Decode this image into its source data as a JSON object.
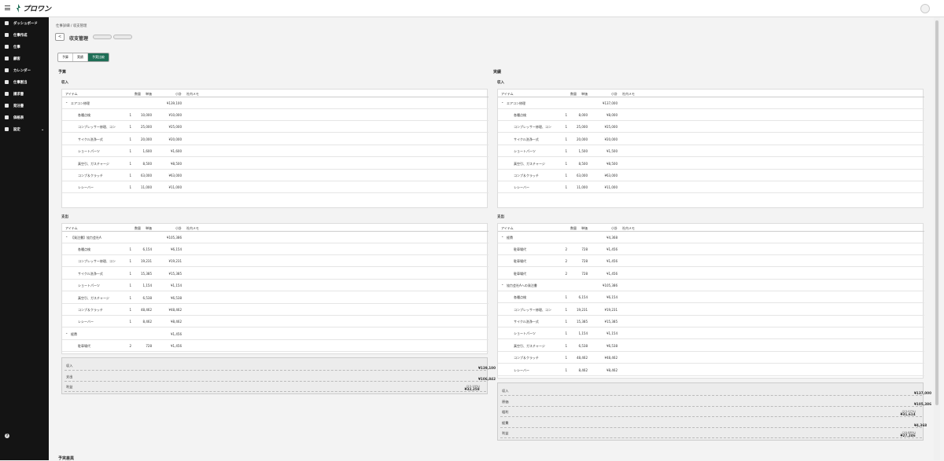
{
  "app": {
    "title": "プロワン"
  },
  "sidebar": {
    "items": [
      {
        "icon": "dashboard-icon",
        "label": "ダッシュボード"
      },
      {
        "icon": "job-create-icon",
        "label": "仕事作成"
      },
      {
        "icon": "job-icon",
        "label": "仕事"
      },
      {
        "icon": "customer-icon",
        "label": "顧客"
      },
      {
        "icon": "calendar-icon",
        "label": "カレンダー"
      },
      {
        "icon": "dispatch-icon",
        "label": "仕事割当"
      },
      {
        "icon": "invoice-icon",
        "label": "請求書"
      },
      {
        "icon": "order-icon",
        "label": "発注書"
      },
      {
        "icon": "price-icon",
        "label": "価格表"
      },
      {
        "icon": "gear-icon",
        "label": "設定"
      }
    ]
  },
  "breadcrumb": {
    "parent": "仕事詳細",
    "sep": "/",
    "current": "収支管理"
  },
  "page": {
    "title": "収支管理",
    "back": "<"
  },
  "tabs": [
    "予算",
    "実績",
    "予実比較"
  ],
  "budget": {
    "title": "予算",
    "income": {
      "title": "収入",
      "header": [
        "アイテム",
        "数量",
        "単価",
        "小計",
        "社内メモ"
      ],
      "group": {
        "name": "エアコン修理",
        "subtotal": "¥139,100"
      },
      "rows": [
        [
          "各種点検",
          "1",
          "10,000",
          "¥10,000"
        ],
        [
          "コンプレッサー修理、コン",
          "1",
          "25,000",
          "¥25,000"
        ],
        [
          "サイクル洗浄一式",
          "1",
          "20,000",
          "¥20,000"
        ],
        [
          "ショートパーツ",
          "1",
          "1,600",
          "¥1,600"
        ],
        [
          "真空引、ガスチャージ",
          "1",
          "8,500",
          "¥8,500"
        ],
        [
          "コンプ＆クラッチ",
          "1",
          "63,000",
          "¥63,000"
        ],
        [
          "レシーバー",
          "1",
          "11,000",
          "¥11,000"
        ]
      ]
    },
    "expense": {
      "title": "支出",
      "header": [
        "アイテム",
        "数量",
        "単価",
        "小計",
        "社内メモ"
      ],
      "group1": {
        "name": "【発注書】協力会社A",
        "subtotal": "¥105,386"
      },
      "rows1": [
        [
          "各種点検",
          "1",
          "6,154",
          "¥6,154"
        ],
        [
          "コンプレッサー修理、コン",
          "1",
          "19,231",
          "¥19,231"
        ],
        [
          "サイクル洗浄一式",
          "1",
          "15,385",
          "¥15,385"
        ],
        [
          "ショートパーツ",
          "1",
          "1,154",
          "¥1,154"
        ],
        [
          "真空引、ガスチャージ",
          "1",
          "6,538",
          "¥6,538"
        ],
        [
          "コンプ＆クラッチ",
          "1",
          "48,462",
          "¥48,462"
        ],
        [
          "レシーバー",
          "1",
          "8,462",
          "¥8,462"
        ]
      ],
      "group2": {
        "name": "経費",
        "subtotal": "¥1,456"
      },
      "rows2": [
        [
          "駐車場代",
          "2",
          "728",
          "¥1,456"
        ]
      ]
    },
    "summary": [
      {
        "label": "収入",
        "value": "¥139,100",
        "pct": ""
      },
      {
        "label": "支出",
        "value": "¥106,842",
        "pct": ""
      },
      {
        "label": "利益",
        "value": "¥32,258",
        "pct": "(23.19%)"
      }
    ]
  },
  "actual": {
    "title": "実績",
    "income": {
      "title": "収入",
      "header": [
        "アイテム",
        "数量",
        "単価",
        "小計",
        "社内メモ"
      ],
      "group": {
        "name": "エアコン修理",
        "subtotal": "¥137,000"
      },
      "rows": [
        [
          "各種点検",
          "1",
          "8,000",
          "¥8,000"
        ],
        [
          "コンプレッサー修理、コン",
          "1",
          "25,000",
          "¥25,000"
        ],
        [
          "サイクル洗浄一式",
          "1",
          "20,000",
          "¥20,000"
        ],
        [
          "ショートパーツ",
          "1",
          "1,500",
          "¥1,500"
        ],
        [
          "真空引、ガスチャージ",
          "1",
          "8,500",
          "¥8,500"
        ],
        [
          "コンプ＆クラッチ",
          "1",
          "63,000",
          "¥63,000"
        ],
        [
          "レシーバー",
          "1",
          "11,000",
          "¥11,000"
        ]
      ]
    },
    "expense": {
      "title": "支出",
      "header": [
        "アイテム",
        "数量",
        "単価",
        "小計",
        "社内メモ"
      ],
      "group1": {
        "name": "経費",
        "subtotal": "¥4,368"
      },
      "rows1": [
        [
          "駐車場代",
          "2",
          "728",
          "¥1,456"
        ],
        [
          "駐車場代",
          "2",
          "728",
          "¥1,456"
        ],
        [
          "駐車場代",
          "2",
          "728",
          "¥1,456"
        ]
      ],
      "group2": {
        "name": "協力会社Aへの発注書",
        "subtotal": "¥105,386"
      },
      "rows2": [
        [
          "各種点検",
          "1",
          "6,154",
          "¥6,154"
        ],
        [
          "コンプレッサー修理、コン",
          "1",
          "19,231",
          "¥19,231"
        ],
        [
          "サイクル洗浄一式",
          "1",
          "15,385",
          "¥15,385"
        ],
        [
          "ショートパーツ",
          "1",
          "1,154",
          "¥1,154"
        ],
        [
          "真空引、ガスチャージ",
          "1",
          "6,538",
          "¥6,538"
        ],
        [
          "コンプ＆クラッチ",
          "1",
          "48,462",
          "¥48,462"
        ],
        [
          "レシーバー",
          "1",
          "8,462",
          "¥8,462"
        ]
      ]
    },
    "summary": [
      {
        "label": "収入",
        "value": "¥137,000",
        "pct": ""
      },
      {
        "label": "原価",
        "value": "¥105,386",
        "pct": ""
      },
      {
        "label": "粗利",
        "value": "¥31,614",
        "pct": "(23.07%)"
      },
      {
        "label": "経費",
        "value": "¥4,368",
        "pct": ""
      },
      {
        "label": "利益",
        "value": "¥27,246",
        "pct": "(19.88%)"
      }
    ]
  },
  "bottom": {
    "title": "予実差異"
  }
}
